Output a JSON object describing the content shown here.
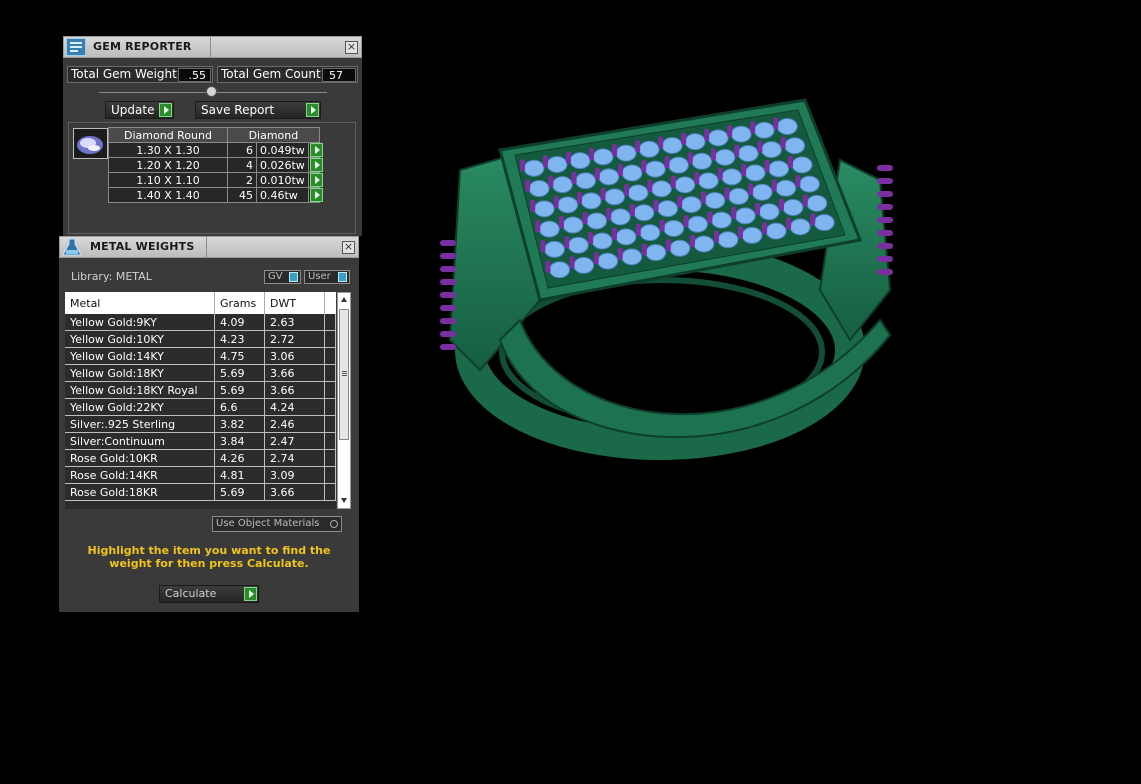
{
  "gem_reporter": {
    "title": "GEM REPORTER",
    "total_weight_label": "Total Gem Weight",
    "total_weight_value": ".55",
    "total_count_label": "Total Gem Count",
    "total_count_value": "57",
    "update_label": "Update",
    "save_report_label": "Save Report",
    "table": {
      "header_shape": "Diamond Round",
      "header_material": "Diamond",
      "rows": [
        {
          "size": "1.30 X 1.30",
          "count": "6",
          "weight": "0.049tw"
        },
        {
          "size": "1.20 X 1.20",
          "count": "4",
          "weight": "0.026tw"
        },
        {
          "size": "1.10 X 1.10",
          "count": "2",
          "weight": "0.010tw"
        },
        {
          "size": "1.40 X 1.40",
          "count": "45",
          "weight": "0.46tw"
        }
      ]
    }
  },
  "metal_weights": {
    "title": "METAL WEIGHTS",
    "library_label": "Library: METAL",
    "toggle_gv": "GV",
    "toggle_user": "User",
    "columns": [
      "Metal",
      "Grams",
      "DWT"
    ],
    "rows": [
      {
        "metal": "Yellow Gold:9KY",
        "grams": "4.09",
        "dwt": "2.63"
      },
      {
        "metal": "Yellow Gold:10KY",
        "grams": "4.23",
        "dwt": "2.72"
      },
      {
        "metal": "Yellow Gold:14KY",
        "grams": "4.75",
        "dwt": "3.06"
      },
      {
        "metal": "Yellow Gold:18KY",
        "grams": "5.69",
        "dwt": "3.66"
      },
      {
        "metal": "Yellow Gold:18KY Royal",
        "grams": "5.69",
        "dwt": "3.66"
      },
      {
        "metal": "Yellow Gold:22KY",
        "grams": "6.6",
        "dwt": "4.24"
      },
      {
        "metal": "Silver:.925 Sterling",
        "grams": "3.82",
        "dwt": "2.46"
      },
      {
        "metal": "Silver:Continuum",
        "grams": "3.84",
        "dwt": "2.47"
      },
      {
        "metal": "Rose Gold:10KR",
        "grams": "4.26",
        "dwt": "2.74"
      },
      {
        "metal": "Rose Gold:14KR",
        "grams": "4.81",
        "dwt": "3.09"
      },
      {
        "metal": "Rose Gold:18KR",
        "grams": "5.69",
        "dwt": "3.66"
      }
    ],
    "use_object_materials_label": "Use Object Materials",
    "hint": "Highlight the item you want to find the weight for then press Calculate.",
    "calculate_label": "Calculate"
  },
  "colors": {
    "ring_metal": "#1f7a55",
    "gem_blue": "#7fb6f0",
    "prong_purple": "#7a2fa0",
    "accent_green": "#2b8a2b",
    "hint_yellow": "#f0c419"
  }
}
